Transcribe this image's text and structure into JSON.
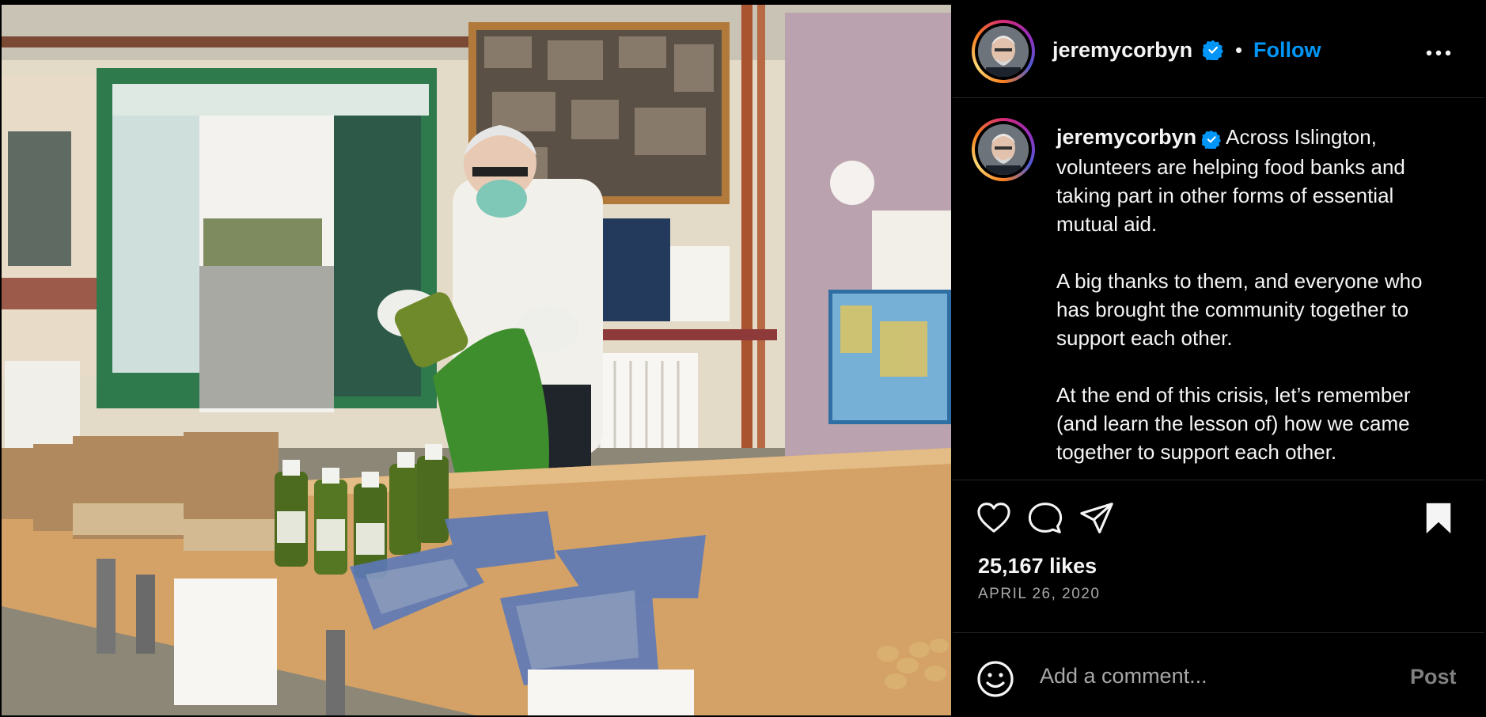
{
  "post": {
    "username": "jeremycorbyn",
    "follow_label": "Follow",
    "separator": "•",
    "caption": "Across Islington, volunteers are helping food banks and taking part in other forms of essential mutual aid.\n\nA big thanks to them, and everyone who has brought the community together to support each other.\n\nAt the end of this crisis, let’s remember (and learn the lesson of) how we came together to support each other.",
    "likes": "25,167 likes",
    "date": "APRIL 26, 2020",
    "verified": true
  },
  "icons": {
    "verified": "verified-badge-icon",
    "more": "more-options-icon",
    "like": "heart-icon",
    "comment": "comment-icon",
    "share": "share-icon",
    "save": "bookmark-icon",
    "emoji": "emoji-icon"
  },
  "comment_box": {
    "placeholder": "Add a comment...",
    "post_label": "Post"
  },
  "colors": {
    "background": "#000000",
    "link_blue": "#0095f6",
    "verified_blue": "#0095f6",
    "muted": "#a8a8a8"
  }
}
